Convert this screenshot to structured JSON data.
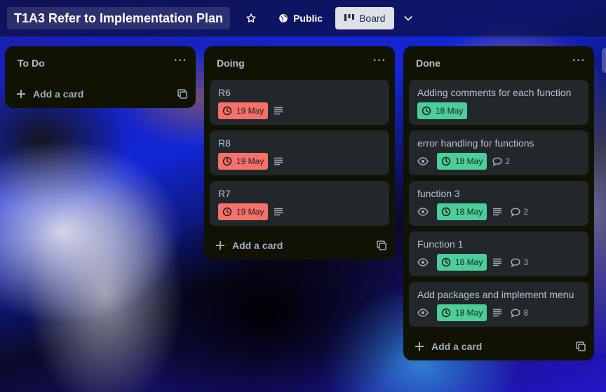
{
  "header": {
    "board_title": "T1A3 Refer to Implementation Plan",
    "star_icon": "star-icon",
    "visibility_label": "Public",
    "view_label": "Board",
    "chevron_icon": "chevron-down-icon"
  },
  "colors": {
    "list_bg": "#101204",
    "card_bg": "#22272b",
    "date_overdue": "#f87168",
    "date_complete": "#4bce97",
    "text": "#b6c2cf"
  },
  "lists": [
    {
      "title": "To Do",
      "menu_label": "···",
      "add_label": "Add a card",
      "cards": []
    },
    {
      "title": "Doing",
      "menu_label": "···",
      "add_label": "Add a card",
      "cards": [
        {
          "title": "R6",
          "due": "19 May",
          "due_status": "overdue",
          "description": true
        },
        {
          "title": "R8",
          "due": "19 May",
          "due_status": "overdue",
          "description": true
        },
        {
          "title": "R7",
          "due": "19 May",
          "due_status": "overdue",
          "description": true
        }
      ]
    },
    {
      "title": "Done",
      "menu_label": "···",
      "add_label": "Add a card",
      "cards": [
        {
          "title": "Adding comments for each function",
          "due": "18 May",
          "due_status": "complete"
        },
        {
          "title": "error handling for functions",
          "watching": true,
          "due": "18 May",
          "due_status": "complete",
          "comments": "2"
        },
        {
          "title": "function 3",
          "watching": true,
          "due": "18 May",
          "due_status": "complete",
          "description": true,
          "comments": "2"
        },
        {
          "title": "Function 1",
          "watching": true,
          "due": "18 May",
          "due_status": "complete",
          "description": true,
          "comments": "3"
        },
        {
          "title": "Add packages and implement menu",
          "watching": true,
          "due": "18 May",
          "due_status": "complete",
          "description": true,
          "comments": "8"
        }
      ]
    }
  ]
}
